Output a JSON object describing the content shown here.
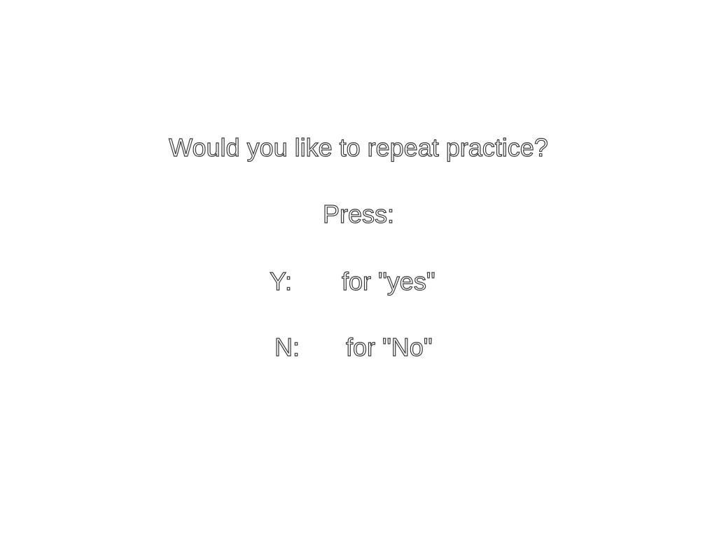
{
  "prompt": {
    "question": "Would you like to repeat practice?",
    "press_label": "Press:",
    "options": [
      {
        "key": "Y:",
        "description": "for \"yes\""
      },
      {
        "key": "N:",
        "description": "for \"No\""
      }
    ]
  },
  "colors": {
    "background": "#ffffff",
    "text_fill": "#ffffff",
    "text_outline": "#3a3a3a"
  }
}
